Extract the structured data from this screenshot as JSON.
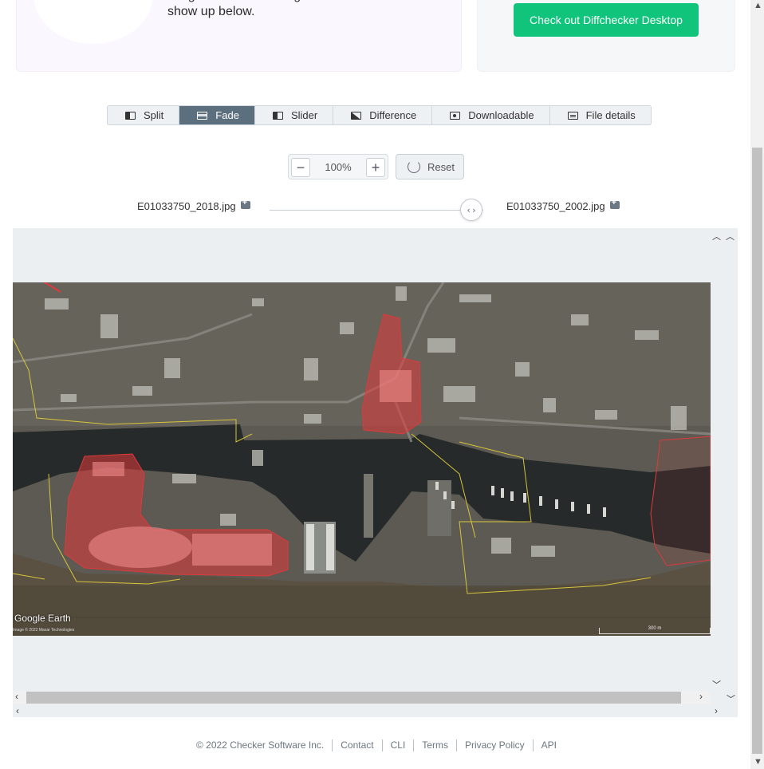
{
  "promo": {
    "text": "images. Enter two images and the difference will show up below.",
    "cta_label": "Check out Diffchecker Desktop"
  },
  "tabs": [
    {
      "label": "Split",
      "icon": "split-view-icon",
      "active": false
    },
    {
      "label": "Fade",
      "icon": "fade-view-icon",
      "active": true
    },
    {
      "label": "Slider",
      "icon": "slider-view-icon",
      "active": false
    },
    {
      "label": "Difference",
      "icon": "difference-view-icon",
      "active": false
    },
    {
      "label": "Downloadable",
      "icon": "downloadable-view-icon",
      "active": false
    },
    {
      "label": "File details",
      "icon": "file-details-icon",
      "active": false
    }
  ],
  "zoom": {
    "value": "100%",
    "minus_label": "−",
    "plus_label": "+",
    "reset_label": "Reset"
  },
  "files": {
    "left": "E01033750_2018.jpg",
    "right": "E01033750_2002.jpg"
  },
  "fade_slider": {
    "handle_label": "‹›",
    "position": 0.93
  },
  "map": {
    "logo": "Google Earth",
    "credit": "Image © 2022 Maxar Technologies",
    "scale_label": "300 m"
  },
  "footer": {
    "items": [
      "© 2022 Checker Software Inc.",
      "Contact",
      "CLI",
      "Terms",
      "Privacy Policy",
      "API"
    ]
  },
  "colors": {
    "accent_green": "#10c47b",
    "active_tab": "#5c6f7f",
    "highlight_red": "#e0393b"
  }
}
